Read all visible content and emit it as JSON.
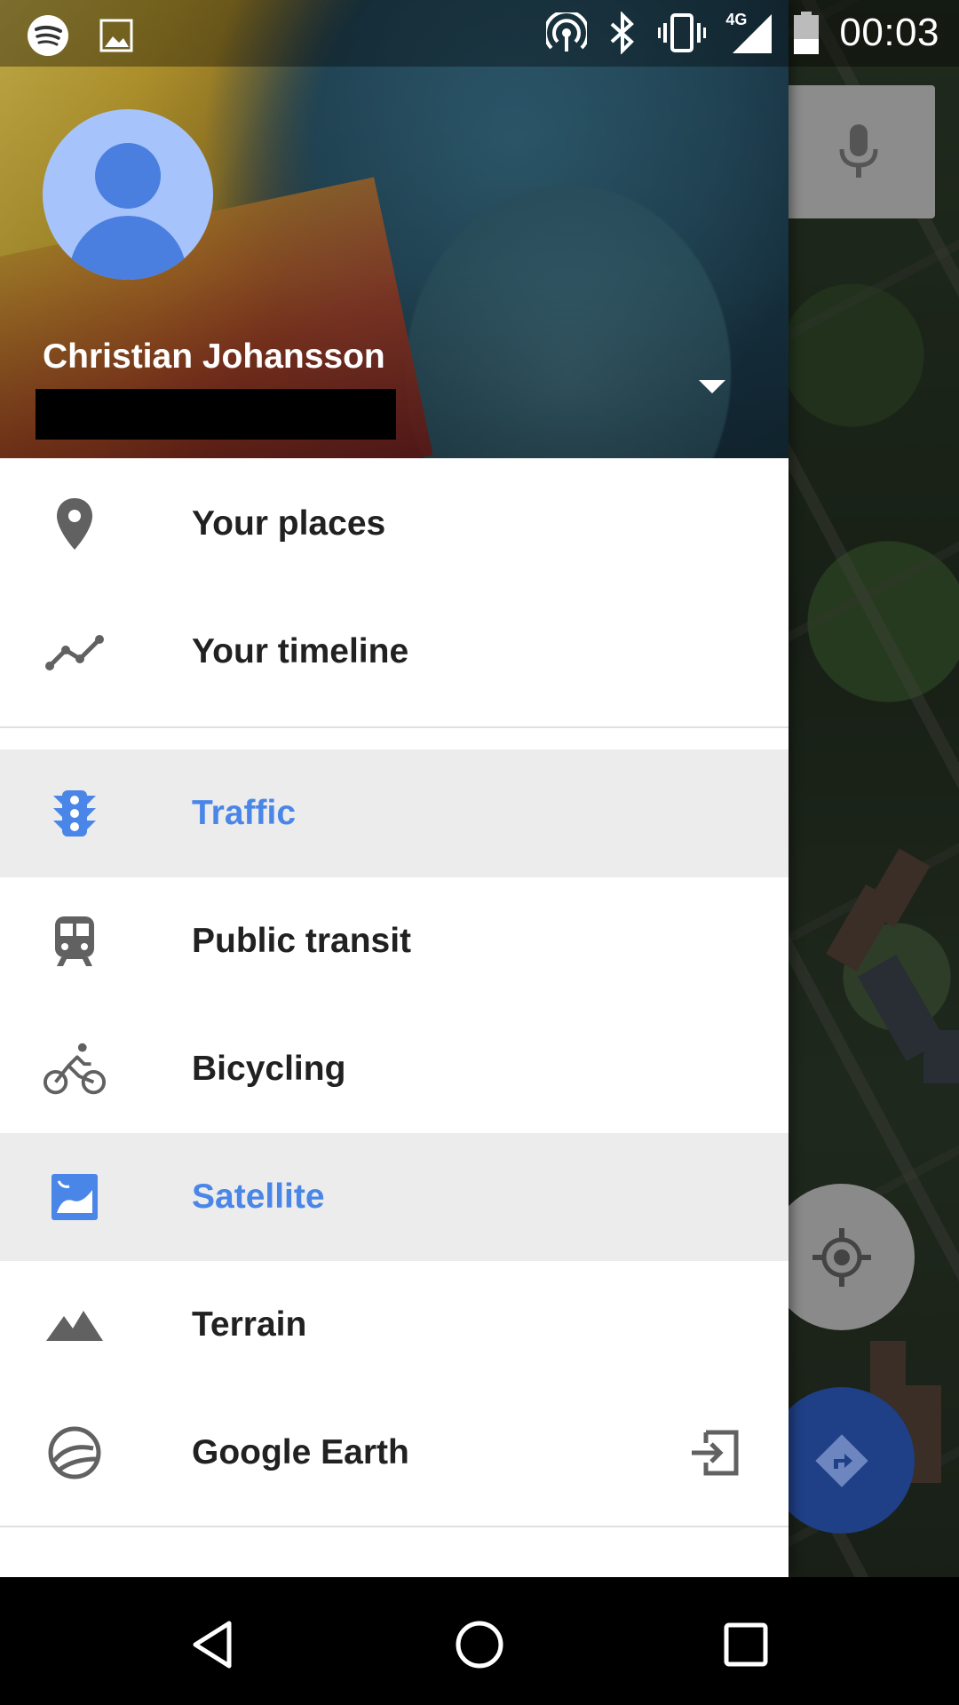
{
  "status_bar": {
    "time": "00:03",
    "network": "4G",
    "icons": [
      "spotify-icon",
      "image-icon",
      "hotspot-icon",
      "bluetooth-icon",
      "vibrate-icon",
      "signal-icon",
      "battery-icon"
    ]
  },
  "drawer": {
    "user": {
      "name": "Christian Johansson"
    },
    "sections": [
      {
        "items": [
          {
            "label": "Your places",
            "icon": "place-pin-icon",
            "active": false
          },
          {
            "label": "Your timeline",
            "icon": "timeline-icon",
            "active": false
          }
        ]
      },
      {
        "items": [
          {
            "label": "Traffic",
            "icon": "traffic-light-icon",
            "active": true
          },
          {
            "label": "Public transit",
            "icon": "train-icon",
            "active": false
          },
          {
            "label": "Bicycling",
            "icon": "bicycle-icon",
            "active": false
          },
          {
            "label": "Satellite",
            "icon": "satellite-image-icon",
            "active": true
          },
          {
            "label": "Terrain",
            "icon": "terrain-icon",
            "active": false
          },
          {
            "label": "Google Earth",
            "icon": "google-earth-icon",
            "active": false,
            "trailing_icon": "open-external-icon"
          }
        ]
      }
    ]
  },
  "colors": {
    "accent": "#4a86e8",
    "active_bg": "#ececec",
    "text": "#212121",
    "directions_fab": "#1f3f86"
  },
  "navigation_bar": {
    "buttons": [
      "back-icon",
      "home-icon",
      "recents-icon"
    ]
  }
}
